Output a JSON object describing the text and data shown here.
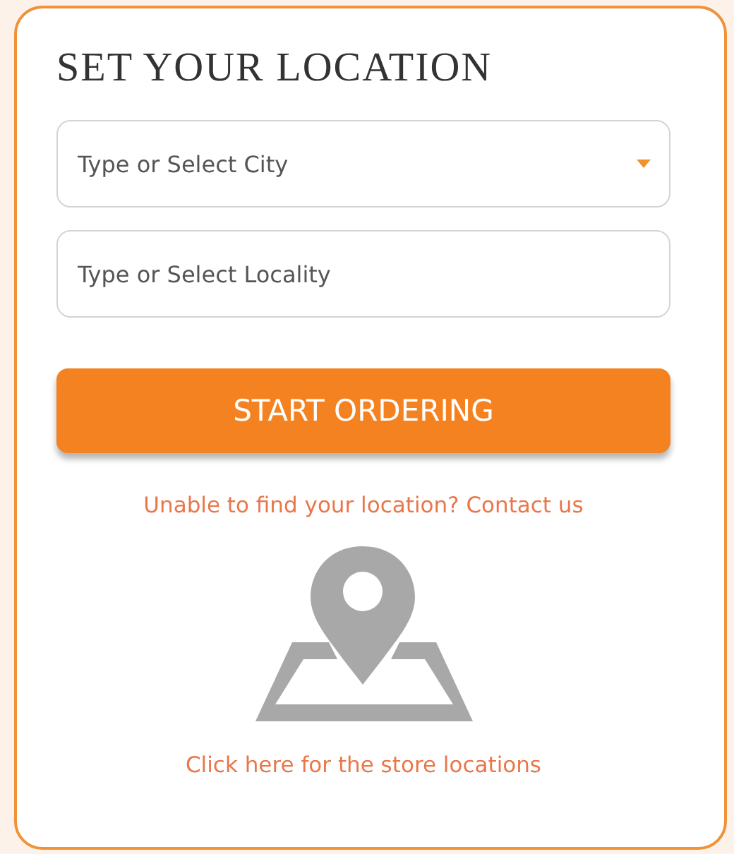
{
  "title": "SET YOUR LOCATION",
  "fields": [
    {
      "kind": "dropdown",
      "placeholder": "Type or Select City"
    },
    {
      "kind": "text",
      "placeholder": "Type or Select Locality"
    }
  ],
  "button": "START ORDERING",
  "help_link": "Unable to find your location? Contact us",
  "store_link": "Click here for the store locations"
}
